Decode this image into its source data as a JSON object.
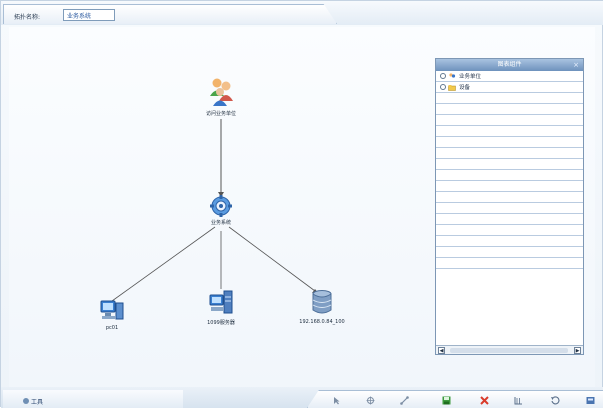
{
  "toolbar": {
    "topology_name_label": "拓扑名称:",
    "topology_name_value": "业务系统"
  },
  "canvas": {
    "nodes": [
      {
        "id": "users",
        "label": "访问业务单位",
        "icon": "user-group-icon"
      },
      {
        "id": "service",
        "label": "业务系统",
        "icon": "gear-service-icon"
      },
      {
        "id": "pc",
        "label": "pc01",
        "icon": "computer-icon"
      },
      {
        "id": "server",
        "label": "1099服务器",
        "icon": "server-icon"
      },
      {
        "id": "db",
        "label": "192.168.0.84_100",
        "icon": "database-icon"
      }
    ]
  },
  "legend": {
    "title": "图表组件",
    "close": "×",
    "items": [
      {
        "label": "业务单位",
        "icon": "user-group-icon"
      },
      {
        "label": "设备",
        "icon": "folder-icon"
      }
    ],
    "empty_rows": 16
  },
  "bottombar": {
    "status_text": "工具"
  },
  "colors": {
    "accent": "#6e92bc",
    "link_line": "#555555",
    "delete_red": "#d93b2b",
    "node_blue": "#3a7fd0"
  }
}
